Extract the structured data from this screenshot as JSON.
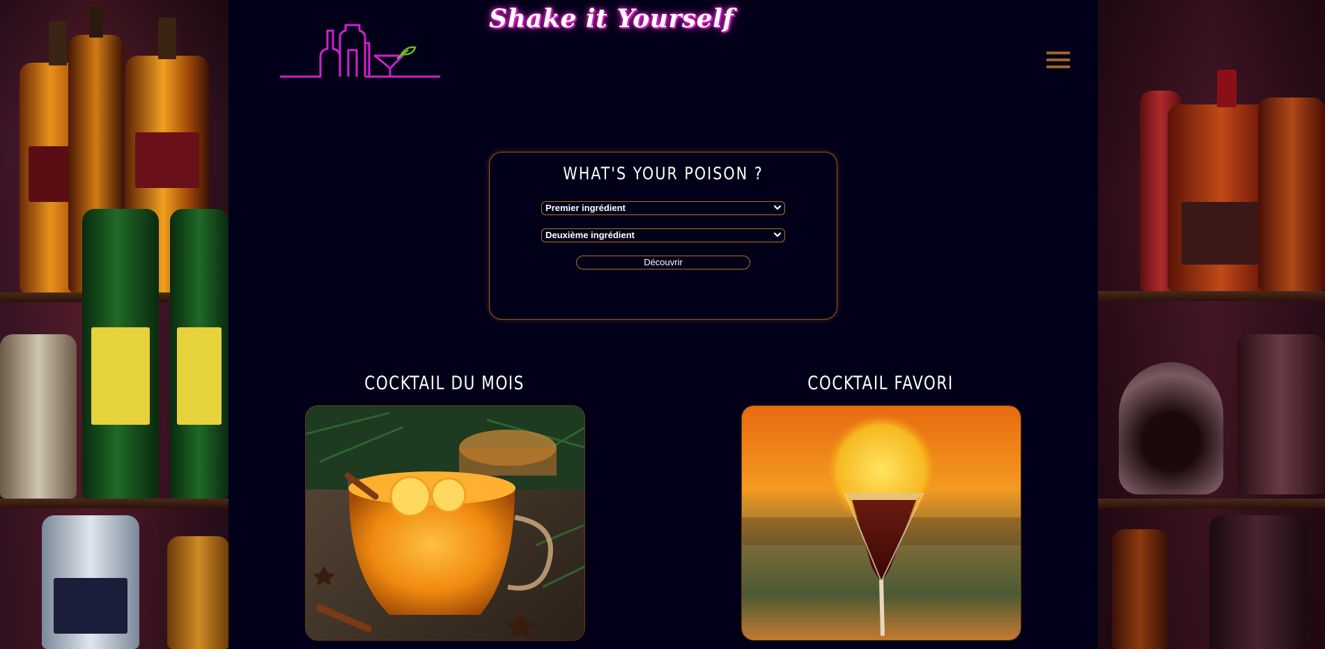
{
  "site": {
    "title": "Shake it Yourself"
  },
  "search": {
    "title": "WHAT'S YOUR POISON ?",
    "first_select": "Premier ingrédient",
    "second_select": "Deuxième ingrédient",
    "button": "Découvrir"
  },
  "cocktails": {
    "month_title": "COCKTAIL DU MOIS",
    "favorite_title": "COCKTAIL FAVORI"
  },
  "colors": {
    "page_bg": "#020018",
    "accent_orange": "#b0702a",
    "neon_pink": "#d21fd0",
    "neon_green": "#6ab820"
  },
  "icons": {
    "menu": "hamburger-icon",
    "logo": "bottles-cocktail-logo",
    "chevron": "chevron-down-icon"
  }
}
